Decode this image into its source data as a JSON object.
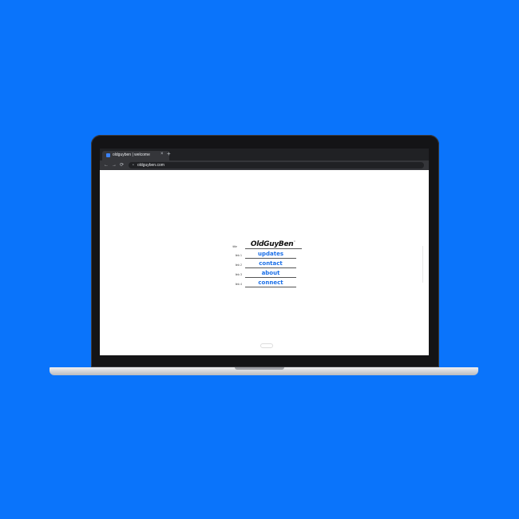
{
  "browser": {
    "tab_title": "oldguyben | welcome",
    "tab_close": "×",
    "new_tab": "+",
    "back": "←",
    "forward": "→",
    "reload": "⟳",
    "lock": "🔒",
    "url": "oldguyben.com"
  },
  "page": {
    "logo": "OldGuyBen",
    "logo_mark": "™",
    "rows": [
      {
        "label": "title"
      },
      {
        "label": "link 1",
        "text": "updates"
      },
      {
        "label": "link 2",
        "text": "contact"
      },
      {
        "label": "link 3",
        "text": "about"
      },
      {
        "label": "link 4",
        "text": "connect"
      }
    ]
  },
  "colors": {
    "background": "#0a74fb",
    "link": "#1a6fe8"
  }
}
